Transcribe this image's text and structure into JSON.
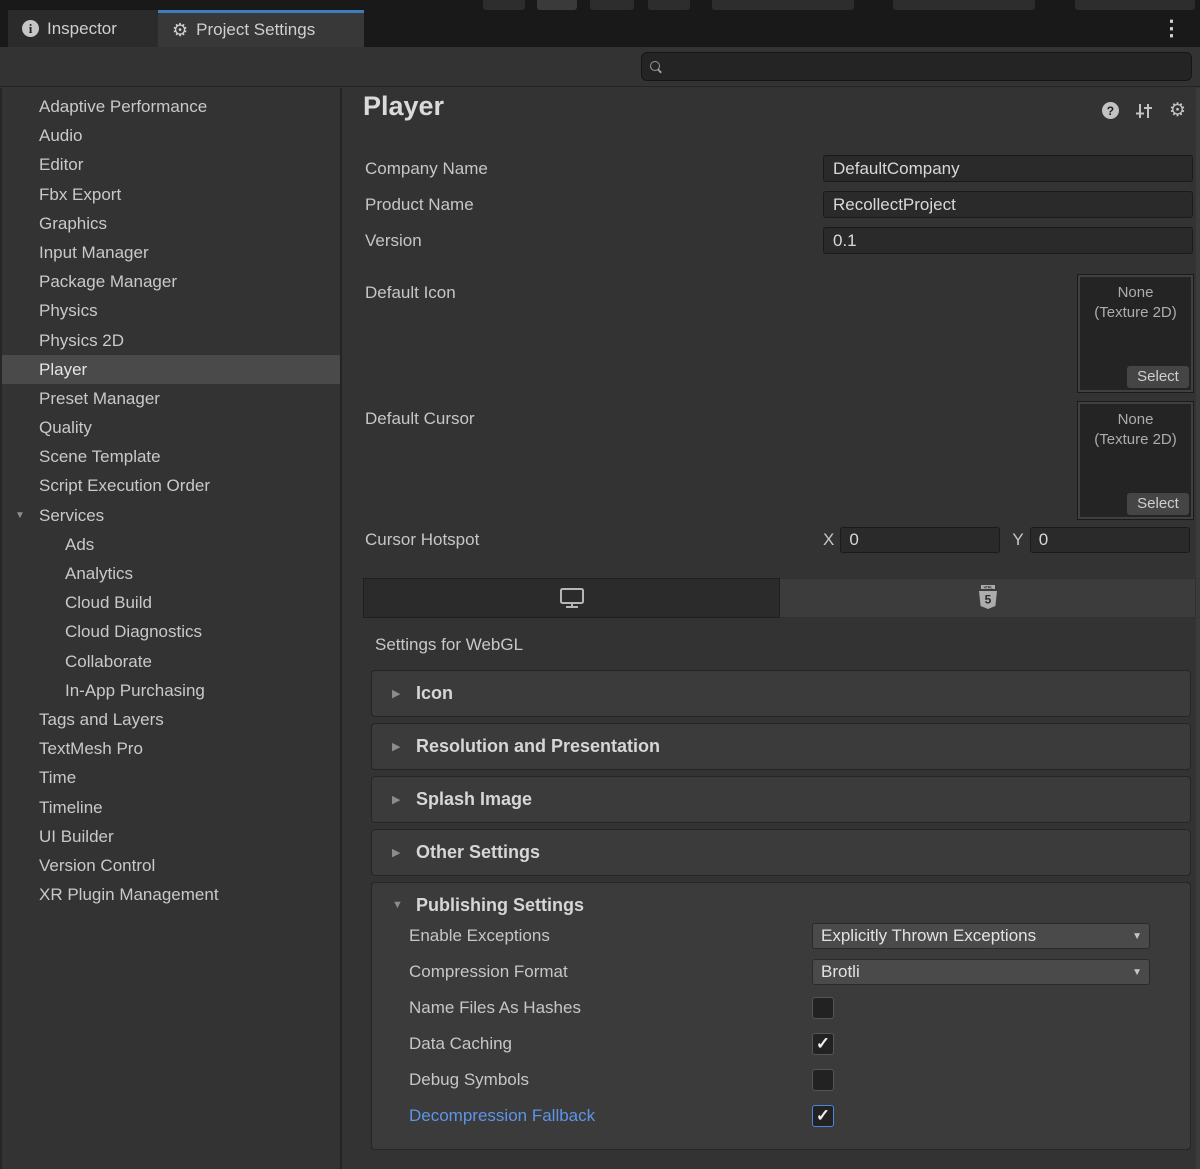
{
  "window": {
    "tabs": [
      {
        "label": "Inspector",
        "active": false
      },
      {
        "label": "Project Settings",
        "active": true
      }
    ],
    "kebab_menu": "⋮",
    "search": {
      "placeholder": "",
      "value": ""
    }
  },
  "sidebar": {
    "items": [
      {
        "label": "Adaptive Performance"
      },
      {
        "label": "Audio"
      },
      {
        "label": "Editor"
      },
      {
        "label": "Fbx Export"
      },
      {
        "label": "Graphics"
      },
      {
        "label": "Input Manager"
      },
      {
        "label": "Package Manager"
      },
      {
        "label": "Physics"
      },
      {
        "label": "Physics 2D"
      },
      {
        "label": "Player",
        "selected": true
      },
      {
        "label": "Preset Manager"
      },
      {
        "label": "Quality"
      },
      {
        "label": "Scene Template"
      },
      {
        "label": "Script Execution Order"
      },
      {
        "label": "Services",
        "expander": "expanded"
      },
      {
        "label": "Ads",
        "indent": 1
      },
      {
        "label": "Analytics",
        "indent": 1
      },
      {
        "label": "Cloud Build",
        "indent": 1
      },
      {
        "label": "Cloud Diagnostics",
        "indent": 1
      },
      {
        "label": "Collaborate",
        "indent": 1
      },
      {
        "label": "In-App Purchasing",
        "indent": 1
      },
      {
        "label": "Tags and Layers"
      },
      {
        "label": "TextMesh Pro"
      },
      {
        "label": "Time"
      },
      {
        "label": "Timeline"
      },
      {
        "label": "UI Builder"
      },
      {
        "label": "Version Control"
      },
      {
        "label": "XR Plugin Management"
      }
    ]
  },
  "main": {
    "title": "Player",
    "fields": [
      {
        "label": "Company Name",
        "value": "DefaultCompany"
      },
      {
        "label": "Product Name",
        "value": "RecollectProject"
      },
      {
        "label": "Version",
        "value": "0.1"
      }
    ],
    "default_icon": {
      "label": "Default Icon",
      "none_label": "None",
      "type_label": "(Texture 2D)",
      "select_label": "Select"
    },
    "default_cursor": {
      "label": "Default Cursor",
      "none_label": "None",
      "type_label": "(Texture 2D)",
      "select_label": "Select"
    },
    "cursor_hotspot": {
      "label": "Cursor Hotspot",
      "x_label": "X",
      "x_value": "0",
      "y_label": "Y",
      "y_value": "0"
    },
    "platform_tabs": [
      {
        "icon": "standalone-monitor",
        "active": false
      },
      {
        "icon": "webgl-html5",
        "active": true
      }
    ],
    "platform_settings_label": "Settings for WebGL",
    "sections": [
      {
        "title": "Icon",
        "expanded": false
      },
      {
        "title": "Resolution and Presentation",
        "expanded": false
      },
      {
        "title": "Splash Image",
        "expanded": false
      },
      {
        "title": "Other Settings",
        "expanded": false
      },
      {
        "title": "Publishing Settings",
        "expanded": true,
        "rows": [
          {
            "label": "Enable Exceptions",
            "type": "dropdown",
            "value": "Explicitly Thrown Exceptions"
          },
          {
            "label": "Compression Format",
            "type": "dropdown",
            "value": "Brotli"
          },
          {
            "label": "Name Files As Hashes",
            "type": "checkbox",
            "checked": false
          },
          {
            "label": "Data Caching",
            "type": "checkbox",
            "checked": true
          },
          {
            "label": "Debug Symbols",
            "type": "checkbox",
            "checked": false
          },
          {
            "label": "Decompression Fallback",
            "type": "checkbox",
            "checked": true,
            "modified": true
          }
        ]
      }
    ]
  },
  "colors": {
    "active_tab_accent": "#3E7BBF",
    "modified_property_blue": "#5E94E8",
    "modified_checkbox_border": "#4C84E0",
    "panel_background": "#333333",
    "selected_row": "#4A4A4A"
  }
}
